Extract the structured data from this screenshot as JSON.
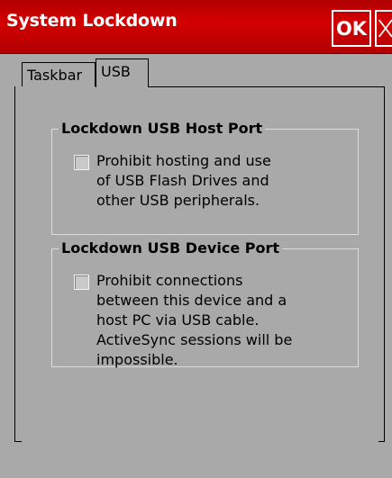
{
  "window": {
    "title": "System Lockdown",
    "ok_label": "OK",
    "close_icon": "close-icon",
    "colors": {
      "titlebar": "#c80000",
      "background": "#a9a9a9",
      "text": "#000000"
    }
  },
  "tabs": [
    {
      "label": "Taskbar",
      "selected": false
    },
    {
      "label": "USB",
      "selected": true
    }
  ],
  "groups": {
    "host": {
      "title": "Lockdown USB Host Port",
      "checkbox_label": "Prohibit hosting and use of USB Flash Drives and other USB peripherals.",
      "checked": false
    },
    "device": {
      "title": "Lockdown USB Device Port",
      "checkbox_label": "Prohibit connections between this device and a host PC via USB cable. ActiveSync sessions will be impossible.",
      "checked": false
    }
  }
}
